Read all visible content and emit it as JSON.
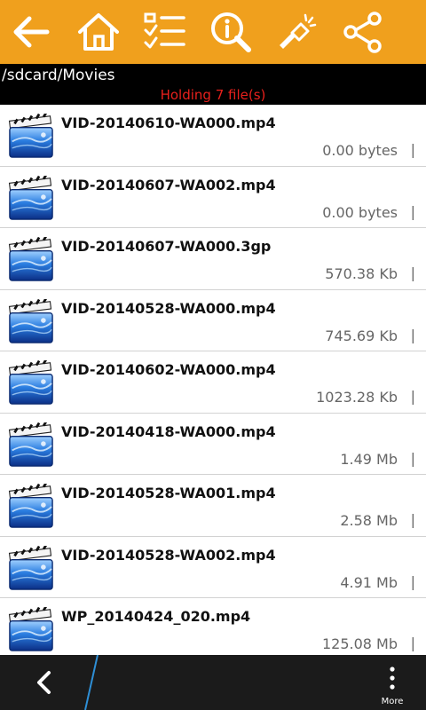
{
  "toolbar": {
    "icons": [
      "back-arrow-icon",
      "home-icon",
      "checklist-icon",
      "info-icon",
      "flashlight-icon",
      "share-icon"
    ]
  },
  "pathbar": {
    "path": "/sdcard/Movies",
    "holding": "Holding 7 file(s)"
  },
  "files": [
    {
      "name": "VID-20140610-WA000.mp4",
      "size": "0.00 bytes"
    },
    {
      "name": "VID-20140607-WA002.mp4",
      "size": "0.00 bytes"
    },
    {
      "name": "VID-20140607-WA000.3gp",
      "size": "570.38 Kb"
    },
    {
      "name": "VID-20140528-WA000.mp4",
      "size": "745.69 Kb"
    },
    {
      "name": "VID-20140602-WA000.mp4",
      "size": "1023.28 Kb"
    },
    {
      "name": "VID-20140418-WA000.mp4",
      "size": "1.49 Mb"
    },
    {
      "name": "VID-20140528-WA001.mp4",
      "size": "2.58 Mb"
    },
    {
      "name": "VID-20140528-WA002.mp4",
      "size": "4.91 Mb"
    },
    {
      "name": "WP_20140424_020.mp4",
      "size": "125.08 Mb"
    }
  ],
  "separator": "|",
  "bottombar": {
    "more_label": "More"
  },
  "colors": {
    "toolbar": "#f0a01d",
    "pathbar": "#000000",
    "holding_text": "#e8201c",
    "bottombar": "#1b1b1b",
    "divider_accent": "#2e8fd6"
  }
}
